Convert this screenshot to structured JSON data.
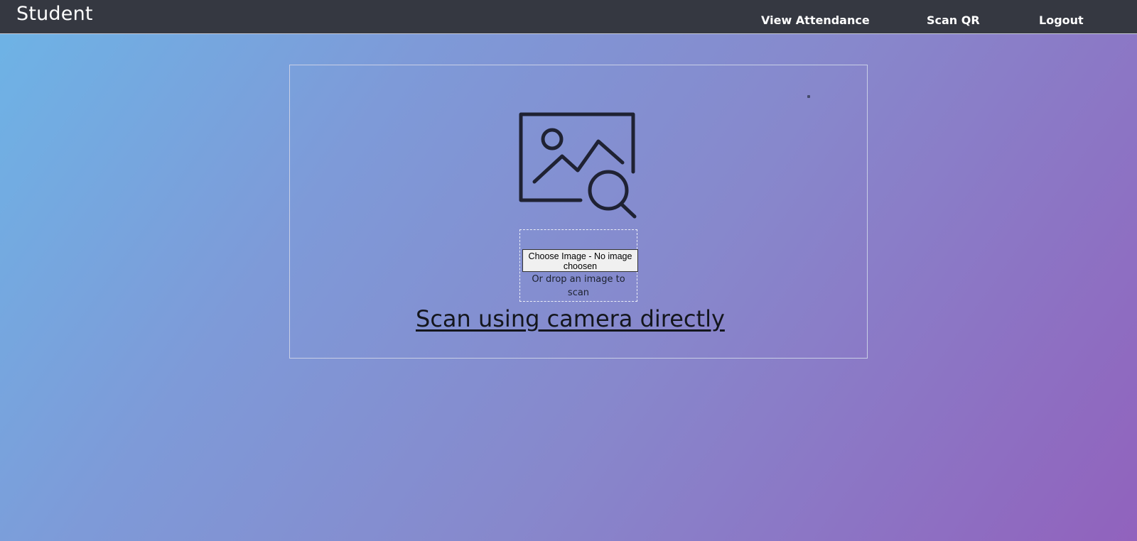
{
  "navbar": {
    "brand": "Student",
    "links": {
      "view_attendance": "View Attendance",
      "scan_qr": "Scan QR",
      "logout": "Logout"
    }
  },
  "scanner": {
    "icon": "image-search-icon",
    "choose_button_label": "Choose Image - No image choosen",
    "drop_text": "Or drop an image to scan",
    "camera_link": "Scan using camera directly"
  },
  "colors": {
    "navbar_bg": "#353841",
    "gradient_start": "#6db4e6",
    "gradient_end": "#9162bd",
    "icon_stroke": "#1f2233"
  }
}
